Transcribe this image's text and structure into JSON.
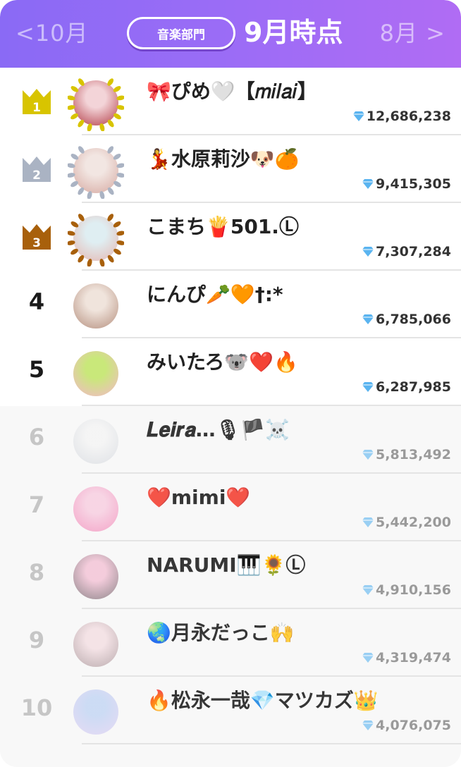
{
  "header": {
    "prev_label": "<10月",
    "next_label": "8月 >",
    "category_label": "音楽部門",
    "title": "9月時点"
  },
  "colors": {
    "header_gradient_start": "#8a6af5",
    "header_gradient_end": "#b06cf4",
    "gold": "#d8c400",
    "silver": "#aab3c3",
    "bronze": "#a8600b",
    "gem": "#5ab4f0"
  },
  "rankings": [
    {
      "rank": "1",
      "name": "🎀ぴめ🤍【𝑚𝑖𝑙𝑎𝑖】",
      "score": "12,686,238",
      "badge": "gold-crown"
    },
    {
      "rank": "2",
      "name": "💃水原莉沙🐶🍊",
      "score": "9,415,305",
      "badge": "silver-crown"
    },
    {
      "rank": "3",
      "name": "こまち🍟501.Ⓛ",
      "score": "7,307,284",
      "badge": "bronze-crown"
    },
    {
      "rank": "4",
      "name": "にんぴ🥕🧡†:*",
      "score": "6,785,066",
      "badge": "none"
    },
    {
      "rank": "5",
      "name": "みいたろ🐨❤️🔥",
      "score": "6,287,985",
      "badge": "none"
    },
    {
      "rank": "6",
      "name": "𝑳𝒆𝒊𝒓𝒂…🎙🏴☠️",
      "score": "5,813,492",
      "badge": "none"
    },
    {
      "rank": "7",
      "name": "❤️mimi❤️",
      "score": "5,442,200",
      "badge": "none"
    },
    {
      "rank": "8",
      "name": "NARUMI🎹🌻Ⓛ",
      "score": "4,910,156",
      "badge": "none"
    },
    {
      "rank": "9",
      "name": "🌏月永だっこ🙌",
      "score": "4,319,474",
      "badge": "none"
    },
    {
      "rank": "10",
      "name": "🔥松永一哉💎マツカズ👑",
      "score": "4,076,075",
      "badge": "none"
    }
  ]
}
